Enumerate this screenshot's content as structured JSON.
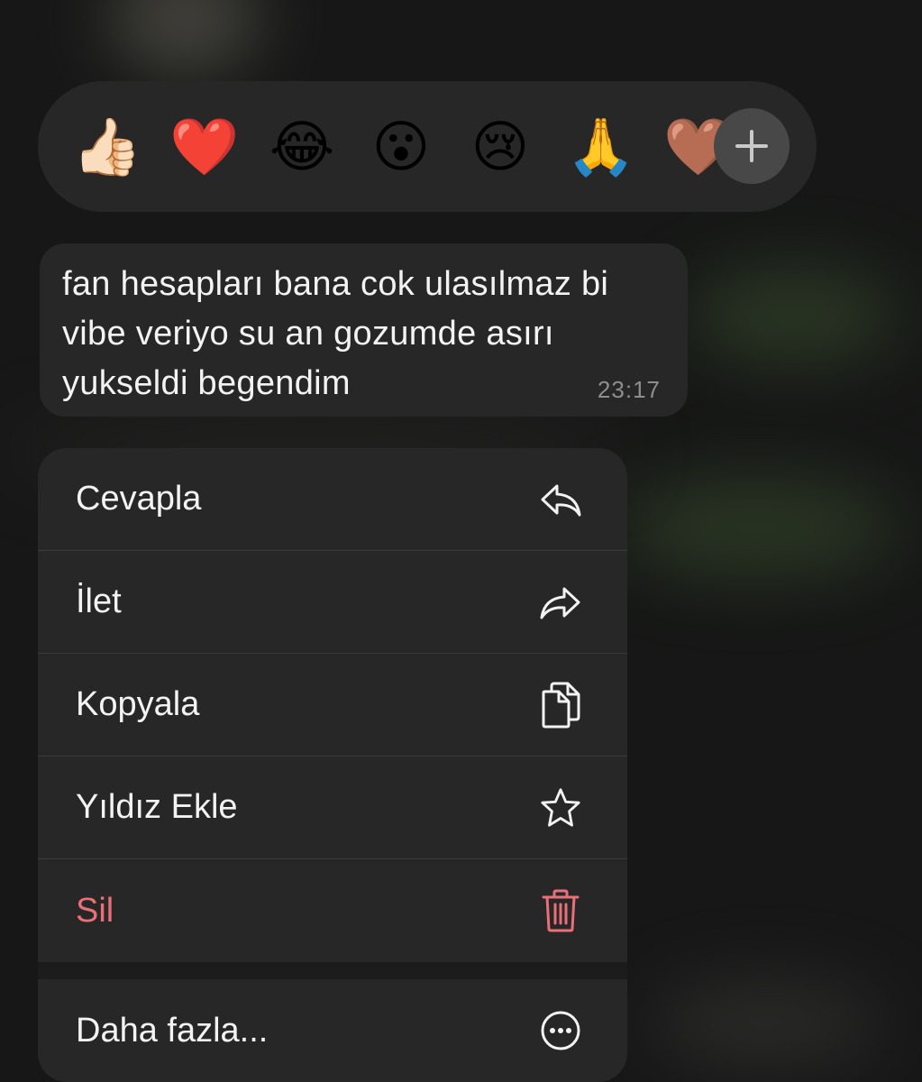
{
  "reactions": {
    "emojis": [
      "👍🏻",
      "❤️",
      "😂",
      "😮",
      "😢",
      "🙏",
      "🤎"
    ],
    "more_icon": "plus-icon"
  },
  "message": {
    "text": "fan hesapları bana cok ulasılmaz bi\nvibe veriyo su an gozumde asırı\nyukseldi begendim",
    "time": "23:17"
  },
  "menu": {
    "items": [
      {
        "label": "Cevapla",
        "icon": "reply-icon"
      },
      {
        "label": "İlet",
        "icon": "forward-icon"
      },
      {
        "label": "Kopyala",
        "icon": "copy-icon"
      },
      {
        "label": "Yıldız Ekle",
        "icon": "star-icon"
      },
      {
        "label": "Sil",
        "icon": "trash-icon"
      }
    ],
    "more": {
      "label": "Daha fazla...",
      "icon": "more-icon"
    }
  },
  "colors": {
    "background": "#161716",
    "surface": "#262726",
    "text": "#f3f3f3",
    "danger": "#ea6f78",
    "timestamp": "#8d8e8d"
  }
}
